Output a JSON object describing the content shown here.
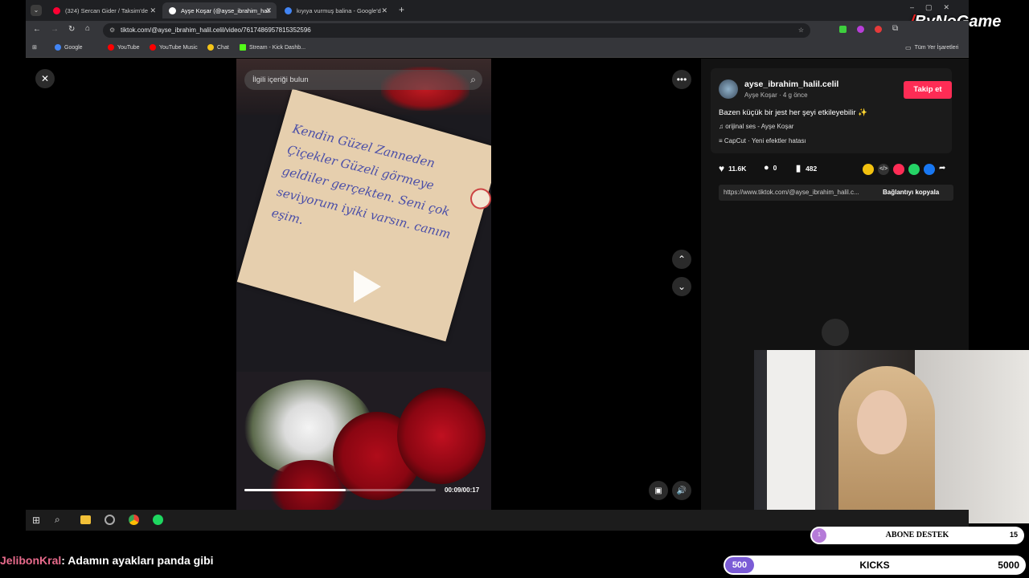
{
  "brand": {
    "logo_text": "ByNoGame"
  },
  "browser": {
    "tabs": [
      {
        "label": "(324) Sercan Gider / Taksim'de",
        "color": "#ff0033"
      },
      {
        "label": "Ayşe Koşar (@ayse_ibrahim_hali",
        "color": "#ffffff"
      },
      {
        "label": "kıyıya vurmuş balina - Google'd",
        "color": "#4285f4"
      }
    ],
    "url": "tiktok.com/@ayse_ibrahim_halil.celil/video/7617486957815352596",
    "bookmarks": [
      {
        "label": "Google",
        "color": "#4285f4"
      },
      {
        "label": "YouTube",
        "color": "#ff0000"
      },
      {
        "label": "YouTube Music",
        "color": "#ff0000"
      },
      {
        "label": "Chat",
        "color": "#f5c518"
      },
      {
        "label": "Stream - Kick Dashb...",
        "color": "#53fc18"
      }
    ],
    "all_bookmarks": "Tüm Yer İşaretleri"
  },
  "tiktok": {
    "search_placeholder": "İlgili içeriği bulun",
    "note_text": "Kendin Güzel Zanneden Çiçekler Güzeli görmeye geldiler gerçekten. Seni çok seviyorum iyiki varsın. canım eşim.",
    "time": "00:09/00:17",
    "progress": 0.53,
    "author": {
      "username": "ayse_ibrahim_halil.celil",
      "meta": "Ayşe Koşar · 4 g önce",
      "follow_label": "Takip et"
    },
    "caption": "Bazen küçük bir jest her şeyi etkileyebilir ✨",
    "sound": "orijinal ses - Ayşe Koşar",
    "effect": "CapCut · Yeni efektler hatası",
    "stats": {
      "likes": "11.6K",
      "comments": "0",
      "saves": "482"
    },
    "share_url": "https://www.tiktok.com/@ayse_ibrahim_halil.c...",
    "copy_link": "Bağlantıyı kopyala"
  },
  "stream": {
    "chat_user": "JelibonKral",
    "chat_message": ": Adamın ayakları panda gibi",
    "goal": {
      "label": "ABONE DESTEK",
      "current": "1",
      "target": "15"
    },
    "kicks": {
      "current": "500",
      "label": "KICKS",
      "target": "5000"
    }
  },
  "colors": {
    "tiktok_red": "#fe2c55",
    "kick_purple": "#7b5cd6"
  }
}
